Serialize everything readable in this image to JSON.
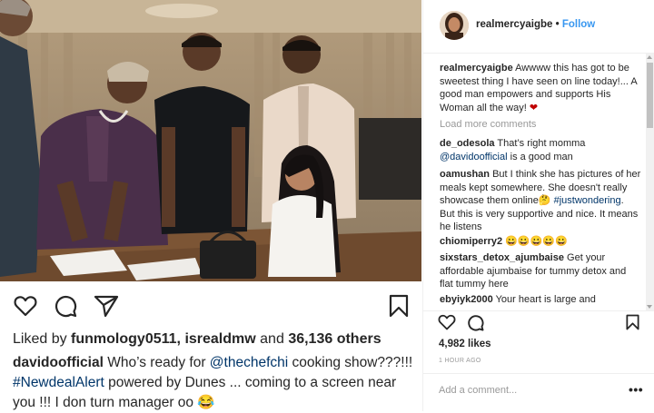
{
  "post": {
    "liked_prefix": "Liked by",
    "liked_user1": "funmology0511",
    "liked_sep": ",",
    "liked_user2": "isrealdmw",
    "liked_and": "and",
    "liked_count": "36,136 others",
    "caption_user": "davidoofficial",
    "caption_t1": "Who’s ready for",
    "caption_mention": "@thechefchi",
    "caption_t2": "cooking show???!!!",
    "caption_hashtag": "#NewdealAlert",
    "caption_t3": "powered by Dunes ... coming to a screen near you !!! I don turn manager oo",
    "caption_emoji": "😂"
  },
  "sidebar": {
    "username": "realmercyaigbe",
    "dot": "•",
    "follow": "Follow",
    "author_caption": "Awwww this has got to be sweetest thing I have seen on line today!... A good man empowers and supports His Woman all the way!",
    "author_heart": "❤",
    "load_more": "Load more comments",
    "comments": [
      {
        "user": "de_odesola",
        "text": "That’s right momma",
        "mention": "@davidoofficial",
        "text2": "is a good man"
      },
      {
        "user": "oamushan",
        "text": "But I think she has pictures of her meals kept somewhere. She doesn't really showcase them online🤔",
        "hashtag": "#justwondering",
        "text2": ". But this is very supportive and nice. It means he listens"
      },
      {
        "user": "chiomiperry2",
        "text": "😀😀😀😀😀"
      },
      {
        "user": "sixstars_detox_ajumbaise",
        "text": "Get your affordable ajumbaise for tummy detox and flat tummy here"
      },
      {
        "user": "ebyiyk2000",
        "text": "Your heart is large and"
      }
    ],
    "likes": "4,982 likes",
    "time": "1 HOUR AGO",
    "add_comment": "Add a comment...",
    "more_dots": "•••"
  },
  "icons": [
    "heart-icon",
    "comment-icon",
    "share-icon",
    "bookmark-icon",
    "more-options-icon"
  ],
  "colors": {
    "follow_blue": "#3897f0",
    "link": "#003569",
    "heart_red": "#c00000",
    "muted": "#999999"
  }
}
